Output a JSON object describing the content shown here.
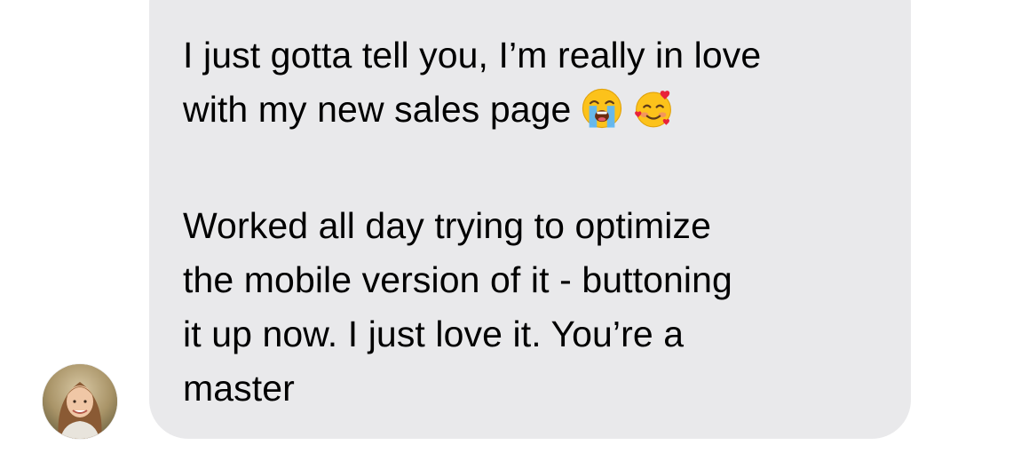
{
  "conversation": {
    "message": {
      "paragraph1": {
        "line1": "I just gotta tell you, I’m really in love",
        "line2": "with my new sales page",
        "emojis": [
          "loudly-crying-face",
          "smiling-face-with-hearts"
        ]
      },
      "paragraph2": {
        "line1": "Worked all day trying to optimize",
        "line2": "the mobile version of it - buttoning",
        "line3": "it up now. I just love it. You’re a",
        "line4": "master"
      }
    },
    "sender": {
      "avatar": "profile-photo"
    }
  },
  "colors": {
    "bubble": "#e9e9eb",
    "text": "#000000",
    "background": "#ffffff"
  }
}
